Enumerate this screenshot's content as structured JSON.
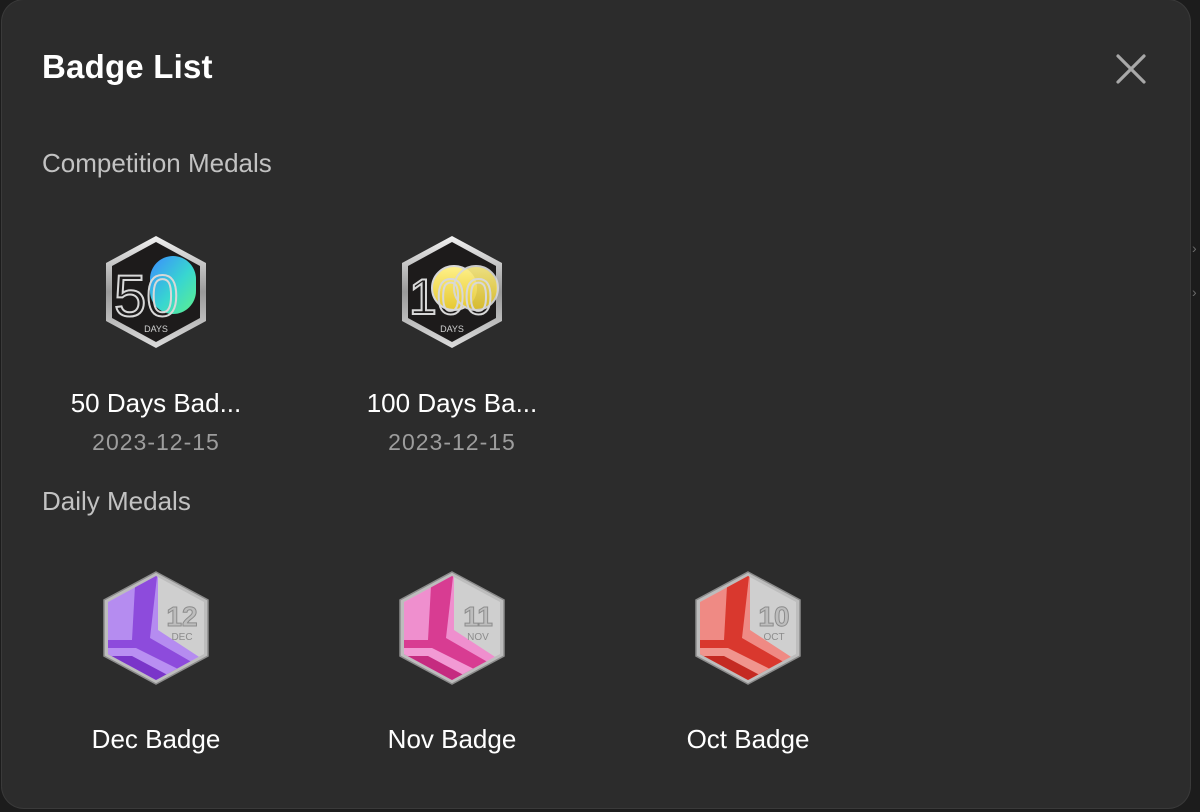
{
  "dialog": {
    "title": "Badge List",
    "close_icon": "close-icon"
  },
  "sections": [
    {
      "title": "Competition Medals",
      "badges": [
        {
          "name": "50 Days Bad...",
          "date": "2023-12-15",
          "number": "50",
          "unit": "DAYS",
          "icon": "fifty-days-medal-icon",
          "accent": "#38d6d0"
        },
        {
          "name": "100 Days Ba...",
          "date": "2023-12-15",
          "number": "100",
          "unit": "DAYS",
          "icon": "hundred-days-medal-icon",
          "accent": "#f0d84a"
        }
      ]
    },
    {
      "title": "Daily Medals",
      "badges": [
        {
          "name": "Dec Badge",
          "day": "12",
          "month": "DEC",
          "icon": "december-medal-icon",
          "accent": "#9a4fe0"
        },
        {
          "name": "Nov Badge",
          "day": "11",
          "month": "NOV",
          "icon": "november-medal-icon",
          "accent": "#e0489e"
        },
        {
          "name": "Oct Badge",
          "day": "10",
          "month": "OCT",
          "icon": "october-medal-icon",
          "accent": "#e0443c"
        }
      ]
    }
  ],
  "colors": {
    "dialog_bg": "#2c2c2c",
    "title": "#ffffff",
    "section_title": "#c2c2c2",
    "date": "#9d9d9d"
  }
}
